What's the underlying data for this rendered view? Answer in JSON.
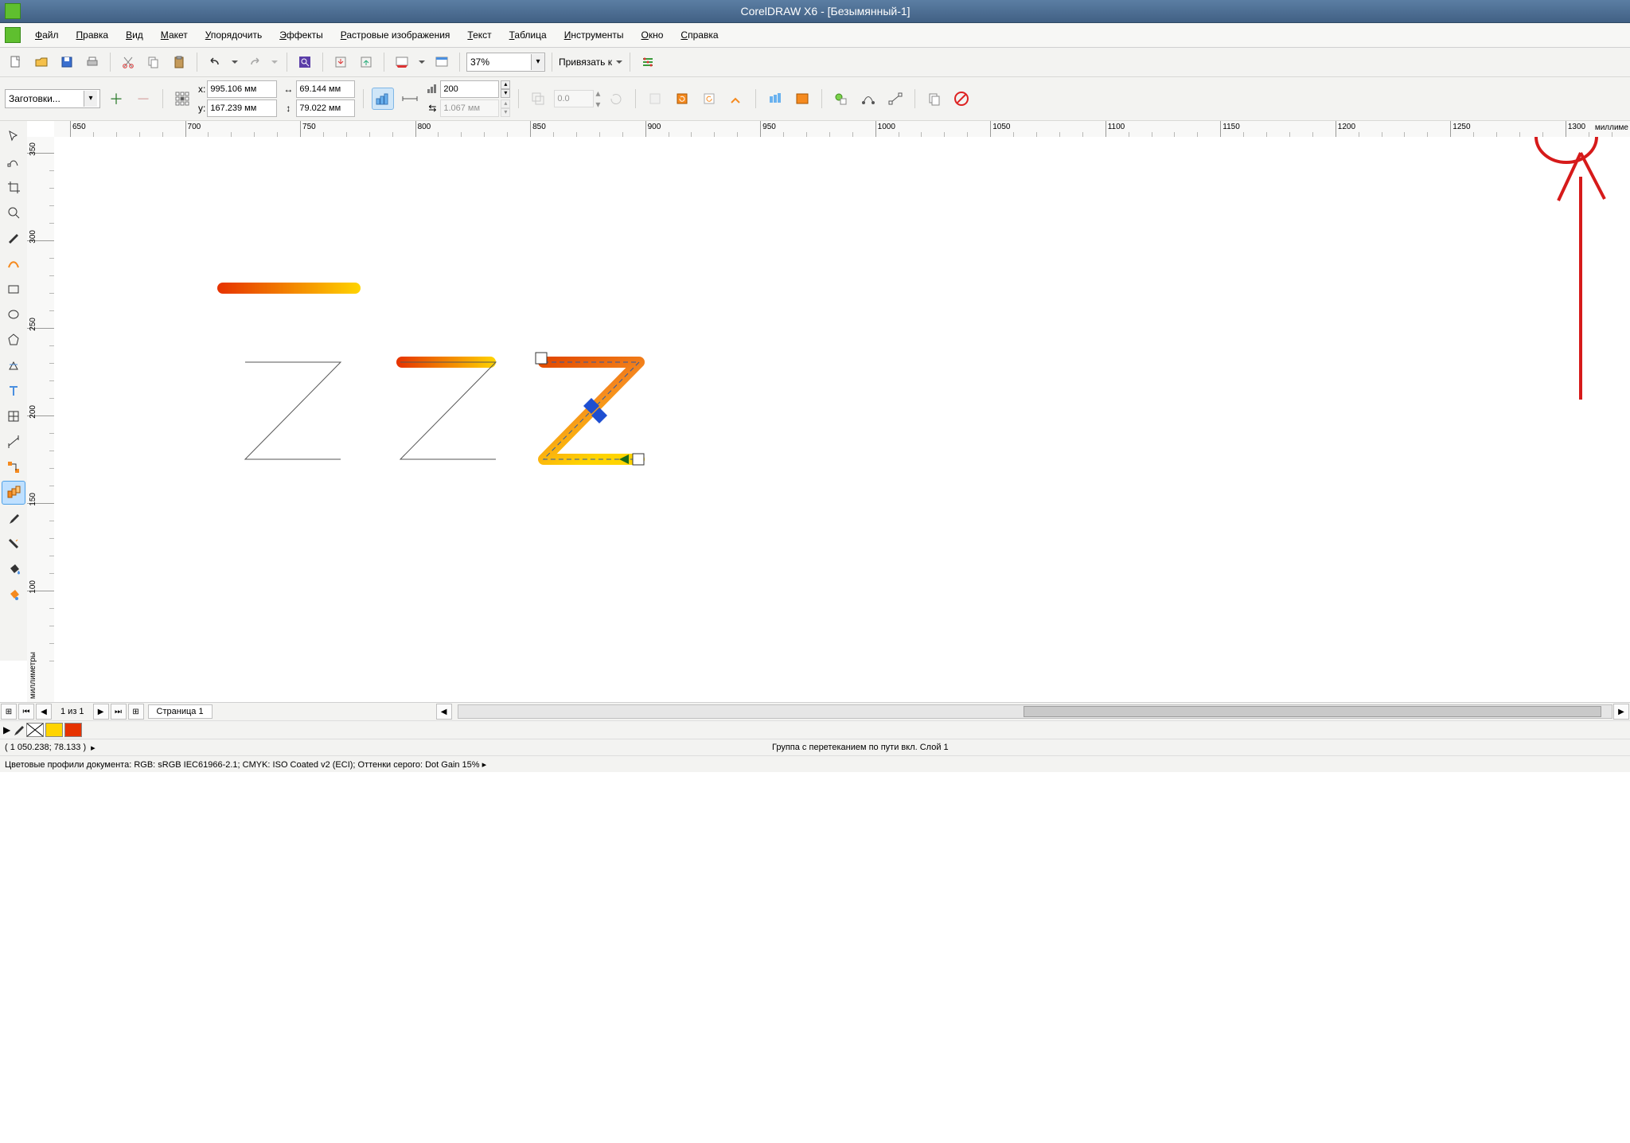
{
  "window": {
    "title": "CorelDRAW X6 - [Безымянный-1]"
  },
  "menu": {
    "items": [
      {
        "label": "Файл",
        "ul": "Ф"
      },
      {
        "label": "Правка",
        "ul": "П"
      },
      {
        "label": "Вид",
        "ul": "В"
      },
      {
        "label": "Макет",
        "ul": "М"
      },
      {
        "label": "Упорядочить",
        "ul": "У"
      },
      {
        "label": "Эффекты",
        "ul": "Э"
      },
      {
        "label": "Растровые изображения",
        "ul": "Р"
      },
      {
        "label": "Текст",
        "ul": "Т"
      },
      {
        "label": "Таблица",
        "ul": "Т"
      },
      {
        "label": "Инструменты",
        "ul": "И"
      },
      {
        "label": "Окно",
        "ul": "О"
      },
      {
        "label": "Справка",
        "ul": "С"
      }
    ]
  },
  "std_toolbar": {
    "zoom": "37%",
    "snap_label": "Привязать к"
  },
  "prop": {
    "presets_label": "Заготовки...",
    "x_label": "x:",
    "x_val": "995.106 мм",
    "y_label": "y:",
    "y_val": "167.239 мм",
    "w_val": "69.144 мм",
    "h_val": "79.022 мм",
    "steps": "200",
    "offset": "1.067 мм",
    "rotate": "0.0"
  },
  "ruler": {
    "h_ticks": [
      650,
      700,
      750,
      800,
      850,
      900,
      950,
      1000,
      1050,
      1100,
      1150,
      1200,
      1250,
      1300
    ],
    "h_unit": "миллиме",
    "v_ticks": [
      350,
      300,
      250,
      200,
      150,
      100
    ],
    "v_unit": "миллиметры"
  },
  "pagebar": {
    "counter": "1 из 1",
    "tab": "Страница 1"
  },
  "status": {
    "coords": "( 1 050.238; 78.133 )",
    "center": "Группа с перетеканием по пути вкл. Слой 1",
    "profiles": "Цветовые профили документа: RGB: sRGB IEC61966-2.1; CMYK: ISO Coated v2 (ECI); Оттенки серого: Dot Gain 15% ▸"
  },
  "palette": {
    "colors": [
      "#ffffff",
      "#ffd400",
      "#e63200"
    ]
  }
}
